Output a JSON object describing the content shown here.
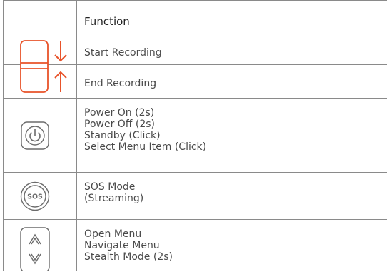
{
  "header": {
    "function_label": "Function"
  },
  "rows": [
    {
      "id": "recording",
      "items": [
        {
          "label": "Start Recording"
        },
        {
          "label": "End Recording"
        }
      ]
    },
    {
      "id": "power",
      "lines": [
        "Power On (2s)",
        "Power Off (2s)",
        "Standby (Click)",
        "Select Menu Item (Click)"
      ]
    },
    {
      "id": "sos",
      "icon_text": "SOS",
      "lines": [
        "SOS Mode",
        "(Streaming)"
      ]
    },
    {
      "id": "menu",
      "lines": [
        "Open Menu",
        "Navigate Menu",
        "Stealth Mode (2s)"
      ]
    }
  ],
  "colors": {
    "accent": "#e8532a",
    "border": "#8a8a8a",
    "icon_gray": "#6b6b6b",
    "text": "#4a4a4a"
  },
  "icons": [
    "record-slider-icon",
    "arrow-down-icon",
    "arrow-up-icon",
    "power-button-icon",
    "sos-button-icon",
    "up-down-button-icon"
  ]
}
